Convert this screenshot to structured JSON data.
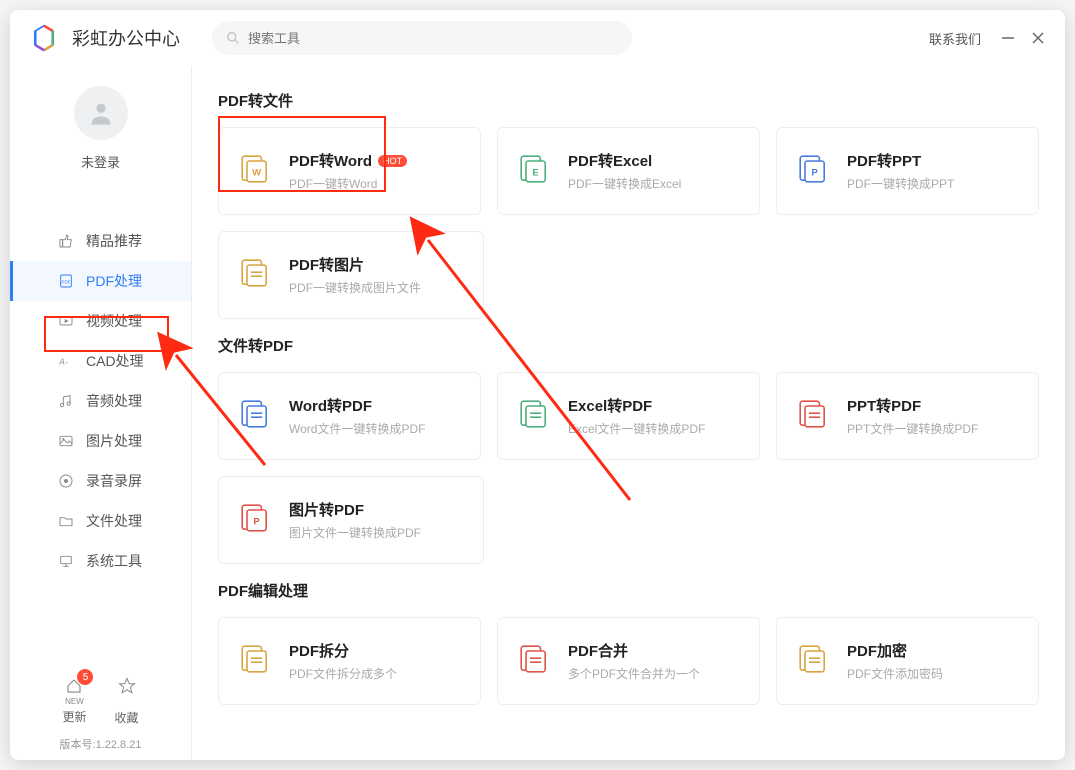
{
  "app_title": "彩虹办公中心",
  "search_placeholder": "搜索工具",
  "contact_label": "联系我们",
  "login_status": "未登录",
  "nav": [
    {
      "icon": "thumbs-up",
      "label": "精品推荐"
    },
    {
      "icon": "pdf",
      "label": "PDF处理",
      "active": true
    },
    {
      "icon": "video",
      "label": "视频处理"
    },
    {
      "icon": "cad",
      "label": "CAD处理"
    },
    {
      "icon": "audio",
      "label": "音频处理"
    },
    {
      "icon": "image",
      "label": "图片处理"
    },
    {
      "icon": "record",
      "label": "录音录屏"
    },
    {
      "icon": "folder",
      "label": "文件处理"
    },
    {
      "icon": "system",
      "label": "系统工具"
    }
  ],
  "sidebar_bottom": {
    "update_label": "更新",
    "favorite_label": "收藏",
    "badge_count": "5",
    "version_label": "版本号:1.22.8.21",
    "new_text": "NEW"
  },
  "sections": [
    {
      "title": "PDF转文件",
      "rows": [
        [
          {
            "icon_color": "#d9a441",
            "icon_letter": "W",
            "title": "PDF转Word",
            "hot": true,
            "desc": "PDF一键转Word"
          },
          {
            "icon_color": "#4caf7d",
            "icon_letter": "E",
            "title": "PDF转Excel",
            "desc": "PDF一键转换成Excel"
          },
          {
            "icon_color": "#4a7ce0",
            "icon_letter": "P",
            "title": "PDF转PPT",
            "desc": "PDF一键转换成PPT"
          }
        ],
        [
          {
            "icon_color": "#d9a441",
            "icon_letter": "",
            "title": "PDF转图片",
            "desc": "PDF一键转换成图片文件"
          }
        ]
      ]
    },
    {
      "title": "文件转PDF",
      "rows": [
        [
          {
            "icon_color": "#4a7ce0",
            "icon_letter": "",
            "title": "Word转PDF",
            "desc": "Word文件一键转换成PDF"
          },
          {
            "icon_color": "#4caf7d",
            "icon_letter": "",
            "title": "Excel转PDF",
            "desc": "Excel文件一键转换成PDF"
          },
          {
            "icon_color": "#e0554a",
            "icon_letter": "",
            "title": "PPT转PDF",
            "desc": "PPT文件一键转换成PDF"
          }
        ],
        [
          {
            "icon_color": "#e0554a",
            "icon_letter": "P",
            "title": "图片转PDF",
            "desc": "图片文件一键转换成PDF"
          }
        ]
      ]
    },
    {
      "title": "PDF编辑处理",
      "rows": [
        [
          {
            "icon_color": "#d9a441",
            "icon_letter": "",
            "title": "PDF拆分",
            "desc": "PDF文件拆分成多个"
          },
          {
            "icon_color": "#e0554a",
            "icon_letter": "",
            "title": "PDF合并",
            "desc": "多个PDF文件合并为一个"
          },
          {
            "icon_color": "#d9a441",
            "icon_letter": "",
            "title": "PDF加密",
            "desc": "PDF文件添加密码"
          }
        ]
      ]
    }
  ]
}
